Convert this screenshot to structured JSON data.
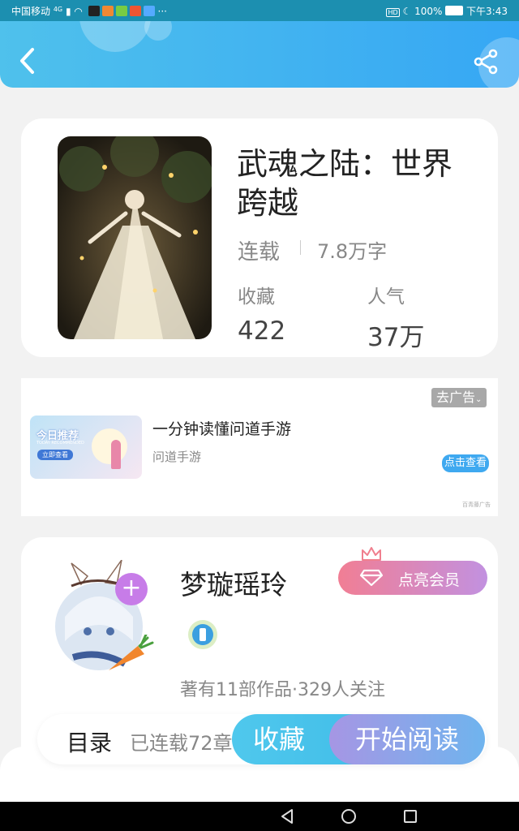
{
  "status": {
    "carrier": "中国移动",
    "network": "4G",
    "dots": "···",
    "battery": "100%",
    "time": "下午3:43",
    "hd": "HD"
  },
  "book": {
    "title": "武魂之陆：世界跨越",
    "status": "连载",
    "words": "7.8万字",
    "fav_label": "收藏",
    "pop_label": "人气",
    "fav_value": "422",
    "pop_value": "37万"
  },
  "ad": {
    "remove_label": "去广告",
    "title": "一分钟读懂问道手游",
    "source": "问道手游",
    "view_button": "点击查看",
    "footer": "百青藤广告",
    "img_title": "今日推荐",
    "img_sub": "TODAY RECOMMENDED",
    "img_btn": "立即查看"
  },
  "author": {
    "name": "梦璇瑶玲",
    "vip_button": "点亮会员",
    "stats": "著有11部作品·329人关注",
    "follow_plus": "+"
  },
  "bottom": {
    "toc_label": "目录",
    "progress": "已连载72章",
    "fav_button": "收藏",
    "read_button": "开始阅读"
  }
}
